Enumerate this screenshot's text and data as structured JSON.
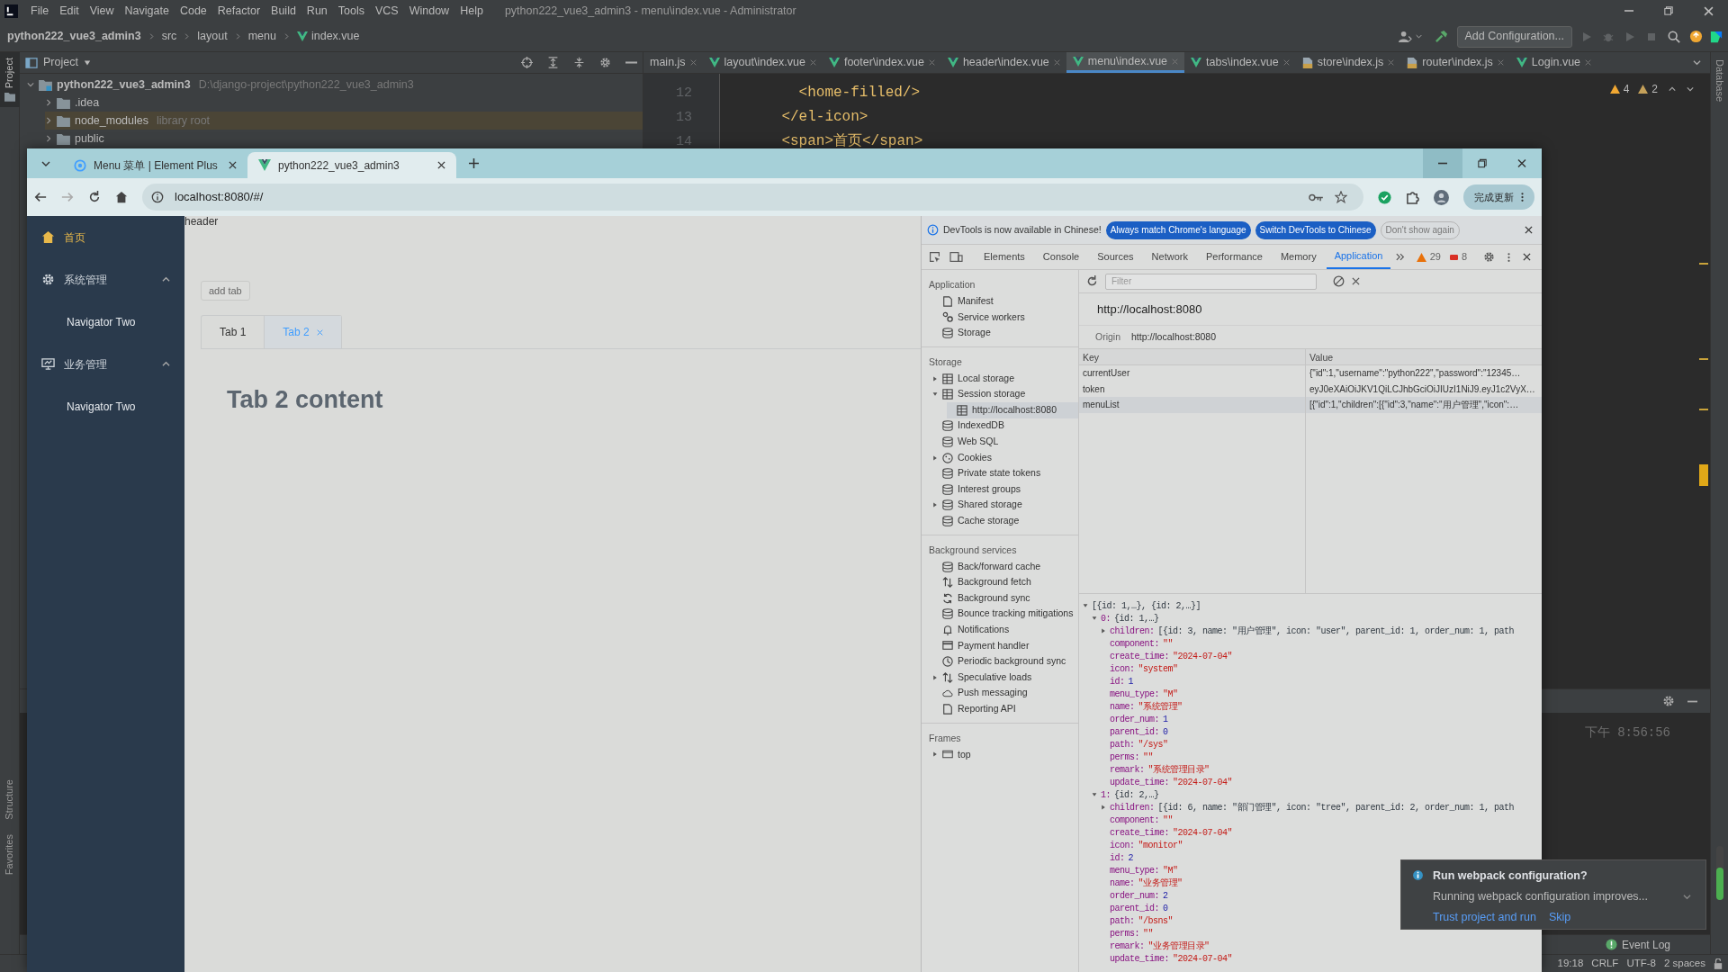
{
  "ide": {
    "menu_bar": {
      "items": [
        "File",
        "Edit",
        "View",
        "Navigate",
        "Code",
        "Refactor",
        "Build",
        "Run",
        "Tools",
        "VCS",
        "Window",
        "Help"
      ],
      "title": "python222_vue3_admin3 - menu\\index.vue - Administrator"
    },
    "nav_bar": {
      "breadcrumbs": [
        {
          "label": "python222_vue3_admin3",
          "kind": "project"
        },
        {
          "label": "src",
          "kind": "folder"
        },
        {
          "label": "layout",
          "kind": "folder"
        },
        {
          "label": "menu",
          "kind": "folder"
        },
        {
          "label": "index.vue",
          "kind": "vue"
        }
      ],
      "run_config": "Add Configuration..."
    },
    "left_strip": {
      "top": "Project",
      "bottom": [
        "Structure",
        "Favorites"
      ]
    },
    "right_strip": "Database",
    "project": {
      "title": "Project",
      "tree": [
        {
          "name": "python222_vue3_admin3",
          "hint": "D:\\django-project\\python222_vue3_admin3",
          "kind": "module",
          "expanded": true,
          "children": [
            {
              "name": ".idea",
              "kind": "folder",
              "expanded": false
            },
            {
              "name": "node_modules",
              "hint": "library root",
              "kind": "library",
              "expanded": false
            },
            {
              "name": "public",
              "kind": "folder",
              "expanded": false
            }
          ]
        }
      ]
    },
    "editor_tabs": [
      {
        "label": "main.js",
        "selected": false
      },
      {
        "label": "layout\\index.vue",
        "kind": "vue",
        "selected": false
      },
      {
        "label": "footer\\index.vue",
        "kind": "vue",
        "selected": false
      },
      {
        "label": "header\\index.vue",
        "kind": "vue",
        "selected": false
      },
      {
        "label": "menu\\index.vue",
        "kind": "vue",
        "selected": true
      },
      {
        "label": "tabs\\index.vue",
        "kind": "vue",
        "selected": false
      },
      {
        "label": "store\\index.js",
        "kind": "js",
        "selected": false
      },
      {
        "label": "router\\index.js",
        "kind": "js",
        "selected": false
      },
      {
        "label": "Login.vue",
        "kind": "vue",
        "selected": false
      }
    ],
    "code_lines": [
      {
        "number": "12",
        "text": "      <home-filled/>",
        "kind": "tag"
      },
      {
        "number": "13",
        "text": "    </el-icon>",
        "kind": "tag"
      },
      {
        "number": "14",
        "text": "    <span>首页</span>",
        "kind": "tag"
      }
    ],
    "inspections": {
      "warnings": "4",
      "weak_warnings": "2"
    },
    "terminal": {
      "time": "下午 8:56:56"
    },
    "event_log": "Event Log",
    "status_bar": [
      "19:18",
      "CRLF",
      "UTF-8",
      "2 spaces"
    ]
  },
  "browser": {
    "tabs": [
      {
        "title": "Menu 菜单 | Element Plus",
        "kind": "site",
        "selected": false
      },
      {
        "title": "python222_vue3_admin3",
        "kind": "vue",
        "selected": true
      }
    ],
    "address": "localhost:8080/#/",
    "update_button": "完成更新",
    "page": {
      "sidebar": [
        {
          "label": "首页",
          "kind": "item",
          "selected": true
        },
        {
          "label": "系统管理",
          "kind": "submenu",
          "expanded": true,
          "children": [
            {
              "label": "Navigator Two",
              "selected": false
            }
          ]
        },
        {
          "label": "业务管理",
          "kind": "submenu",
          "expanded": true,
          "children": [
            {
              "label": "Navigator Two",
              "selected": false
            }
          ]
        }
      ],
      "header": "header",
      "add_tab": "add tab",
      "tabs": [
        {
          "label": "Tab 1",
          "closable": false,
          "selected": false
        },
        {
          "label": "Tab 2",
          "closable": true,
          "selected": true
        }
      ],
      "content": "Tab 2 content"
    },
    "devtools": {
      "infobar": {
        "message": "DevTools is now available in Chinese!",
        "buttons": [
          {
            "label": "Always match Chrome's language",
            "kind": "primary"
          },
          {
            "label": "Switch DevTools to Chinese",
            "kind": "primary"
          },
          {
            "label": "Don't show again",
            "kind": "secondary"
          }
        ]
      },
      "tabs": [
        {
          "label": "Elements",
          "selected": false
        },
        {
          "label": "Console",
          "selected": false
        },
        {
          "label": "Sources",
          "selected": false
        },
        {
          "label": "Network",
          "selected": false
        },
        {
          "label": "Performance",
          "selected": false
        },
        {
          "label": "Memory",
          "selected": false
        },
        {
          "label": "Application",
          "selected": true
        }
      ],
      "warnings": "29",
      "errors": "8",
      "sidebar": [
        {
          "title": "Application",
          "items": [
            {
              "label": "Manifest",
              "selected": false
            },
            {
              "label": "Service workers",
              "selected": false
            },
            {
              "label": "Storage",
              "selected": false
            }
          ]
        },
        {
          "title": "Storage",
          "items": [
            {
              "label": "Local storage",
              "expanded": false,
              "selected": false
            },
            {
              "label": "Session storage",
              "expanded": true,
              "selected": false,
              "children": [
                {
                  "label": "http://localhost:8080",
                  "selected": true
                }
              ]
            },
            {
              "label": "IndexedDB",
              "selected": false
            },
            {
              "label": "Web SQL",
              "selected": false
            },
            {
              "label": "Cookies",
              "expanded": false,
              "selected": false
            },
            {
              "label": "Private state tokens",
              "selected": false
            },
            {
              "label": "Interest groups",
              "selected": false
            },
            {
              "label": "Shared storage",
              "expanded": false,
              "selected": false
            },
            {
              "label": "Cache storage",
              "selected": false
            }
          ]
        },
        {
          "title": "Background services",
          "items": [
            {
              "label": "Back/forward cache",
              "selected": false
            },
            {
              "label": "Background fetch",
              "selected": false
            },
            {
              "label": "Background sync",
              "selected": false
            },
            {
              "label": "Bounce tracking mitigations",
              "selected": false
            },
            {
              "label": "Notifications",
              "selected": false
            },
            {
              "label": "Payment handler",
              "selected": false
            },
            {
              "label": "Periodic background sync",
              "selected": false
            },
            {
              "label": "Speculative loads",
              "expanded": false,
              "selected": false
            },
            {
              "label": "Push messaging",
              "selected": false
            },
            {
              "label": "Reporting API",
              "selected": false
            }
          ]
        },
        {
          "title": "Frames",
          "items": [
            {
              "label": "top",
              "expanded": false,
              "selected": false
            }
          ]
        }
      ],
      "filter_placeholder": "Filter",
      "origin_title": "http://localhost:8080",
      "origin_label": "Origin",
      "origin_value": "http://localhost:8080",
      "columns": [
        "Key",
        "Value"
      ],
      "rows": [
        {
          "key": "currentUser",
          "value": "{\"id\":1,\"username\":\"python222\",\"password\":\"12345…",
          "selected": false
        },
        {
          "key": "token",
          "value": "eyJ0eXAiOiJKV1QiLCJhbGciOiJIUzI1NiJ9.eyJ1c2VyX…",
          "selected": false
        },
        {
          "key": "menuList",
          "value": "[{\"id\":1,\"children\":[{\"id\":3,\"name\":\"用户管理\",\"icon\":…",
          "selected": true
        }
      ],
      "preview": [
        {
          "value": "[{id: 1,…}, {id: 2,…}]",
          "kind": "object",
          "expanded": true,
          "children": [
            {
              "key": "0:",
              "value": "{id: 1,…}",
              "kind": "object",
              "expanded": true,
              "children": [
                {
                  "key": "children:",
                  "value": "[{id: 3, name: \"用户管理\", icon: \"user\", parent_id: 1, order_num: 1, path",
                  "kind": "object",
                  "expanded": false
                },
                {
                  "key": "component:",
                  "value": "\"\"",
                  "kind": "string"
                },
                {
                  "key": "create_time:",
                  "value": "\"2024-07-04\"",
                  "kind": "string"
                },
                {
                  "key": "icon:",
                  "value": "\"system\"",
                  "kind": "string"
                },
                {
                  "key": "id:",
                  "value": "1",
                  "kind": "number"
                },
                {
                  "key": "menu_type:",
                  "value": "\"M\"",
                  "kind": "string"
                },
                {
                  "key": "name:",
                  "value": "\"系统管理\"",
                  "kind": "string"
                },
                {
                  "key": "order_num:",
                  "value": "1",
                  "kind": "number"
                },
                {
                  "key": "parent_id:",
                  "value": "0",
                  "kind": "number"
                },
                {
                  "key": "path:",
                  "value": "\"/sys\"",
                  "kind": "string"
                },
                {
                  "key": "perms:",
                  "value": "\"\"",
                  "kind": "string"
                },
                {
                  "key": "remark:",
                  "value": "\"系统管理目录\"",
                  "kind": "string"
                },
                {
                  "key": "update_time:",
                  "value": "\"2024-07-04\"",
                  "kind": "string"
                }
              ]
            },
            {
              "key": "1:",
              "value": "{id: 2,…}",
              "kind": "object",
              "expanded": true,
              "children": [
                {
                  "key": "children:",
                  "value": "[{id: 6, name: \"部门管理\", icon: \"tree\", parent_id: 2, order_num: 1, path",
                  "kind": "object",
                  "expanded": false
                },
                {
                  "key": "component:",
                  "value": "\"\"",
                  "kind": "string"
                },
                {
                  "key": "create_time:",
                  "value": "\"2024-07-04\"",
                  "kind": "string"
                },
                {
                  "key": "icon:",
                  "value": "\"monitor\"",
                  "kind": "string"
                },
                {
                  "key": "id:",
                  "value": "2",
                  "kind": "number"
                },
                {
                  "key": "menu_type:",
                  "value": "\"M\"",
                  "kind": "string"
                },
                {
                  "key": "name:",
                  "value": "\"业务管理\"",
                  "kind": "string"
                },
                {
                  "key": "order_num:",
                  "value": "2",
                  "kind": "number"
                },
                {
                  "key": "parent_id:",
                  "value": "0",
                  "kind": "number"
                },
                {
                  "key": "path:",
                  "value": "\"/bsns\"",
                  "kind": "string"
                },
                {
                  "key": "perms:",
                  "value": "\"\"",
                  "kind": "string"
                },
                {
                  "key": "remark:",
                  "value": "\"业务管理目录\"",
                  "kind": "string"
                },
                {
                  "key": "update_time:",
                  "value": "\"2024-07-04\"",
                  "kind": "string"
                }
              ]
            }
          ]
        }
      ]
    }
  },
  "notification": {
    "title": "Run webpack configuration?",
    "text": "Running webpack configuration improves...",
    "actions": [
      "Trust project and run",
      "Skip"
    ]
  }
}
